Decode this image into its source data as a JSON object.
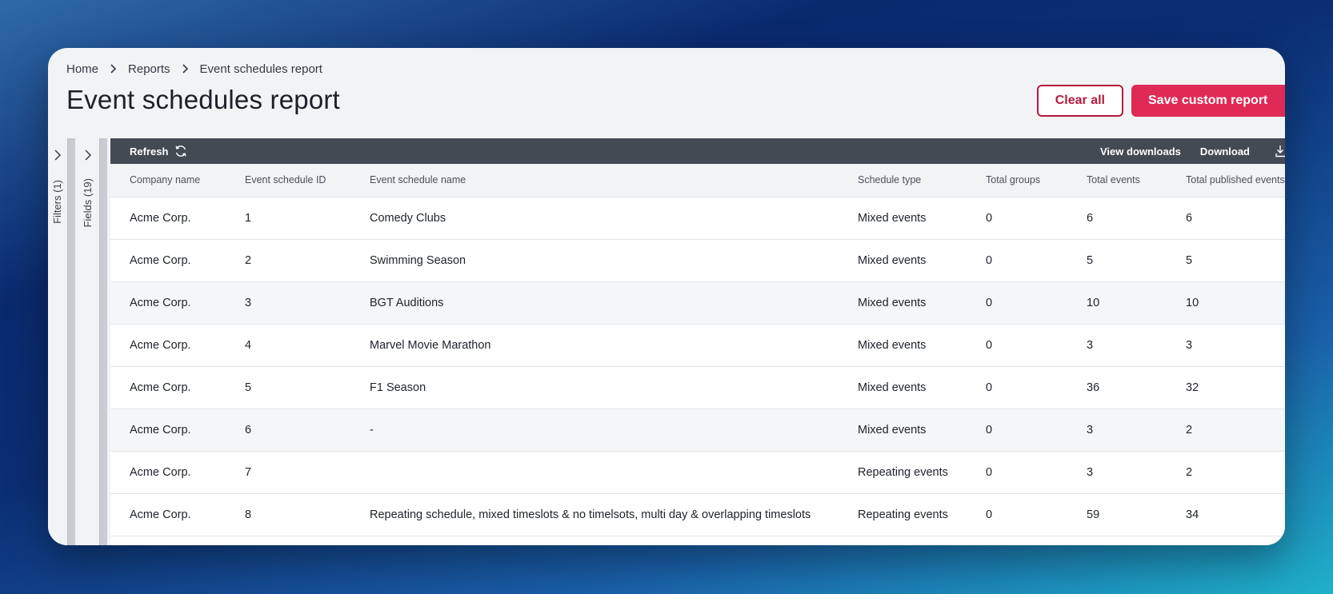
{
  "breadcrumb": [
    "Home",
    "Reports",
    "Event schedules report"
  ],
  "page_title": "Event schedules report",
  "actions": {
    "clear_label": "Clear all",
    "save_label": "Save custom report"
  },
  "side_panels": {
    "filters_label": "Filters (1)",
    "fields_label": "Fields (19)"
  },
  "toolbar": {
    "refresh_label": "Refresh",
    "view_downloads_label": "View downloads",
    "download_label": "Download"
  },
  "table": {
    "columns": [
      "Company name",
      "Event schedule ID",
      "Event schedule name",
      "Schedule type",
      "Total groups",
      "Total events",
      "Total published events"
    ],
    "rows": [
      [
        "Acme Corp.",
        "1",
        "Comedy Clubs",
        "Mixed events",
        "0",
        "6",
        "6"
      ],
      [
        "Acme Corp.",
        "2",
        "Swimming Season",
        "Mixed events",
        "0",
        "5",
        "5"
      ],
      [
        "Acme Corp.",
        "3",
        "BGT Auditions",
        "Mixed events",
        "0",
        "10",
        "10"
      ],
      [
        "Acme Corp.",
        "4",
        "Marvel Movie Marathon",
        "Mixed events",
        "0",
        "3",
        "3"
      ],
      [
        "Acme Corp.",
        "5",
        "F1 Season",
        "Mixed events",
        "0",
        "36",
        "32"
      ],
      [
        "Acme Corp.",
        "6",
        "-",
        "Mixed events",
        "0",
        "3",
        "2"
      ],
      [
        "Acme Corp.",
        "7",
        "",
        "Repeating events",
        "0",
        "3",
        "2"
      ],
      [
        "Acme Corp.",
        "8",
        "Repeating schedule, mixed timeslots & no timelsots, multi day & overlapping timeslots",
        "Repeating events",
        "0",
        "59",
        "34"
      ]
    ]
  },
  "colors": {
    "primary": "#de2a55",
    "outline": "#b51b3c",
    "toolbar": "#424a54"
  }
}
